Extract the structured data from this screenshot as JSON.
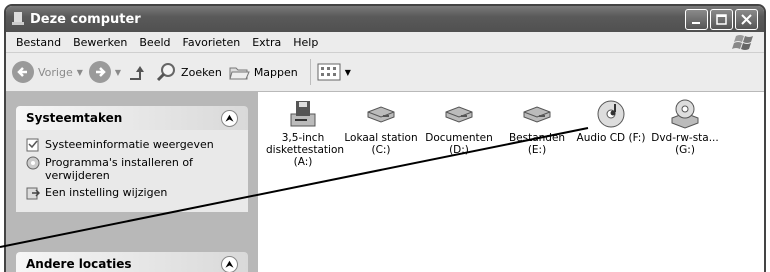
{
  "window": {
    "title": "Deze computer",
    "app_icon": "computer-icon"
  },
  "menubar": {
    "items": [
      "Bestand",
      "Bewerken",
      "Beeld",
      "Favorieten",
      "Extra",
      "Help"
    ]
  },
  "toolbar": {
    "back_label": "Vorige",
    "search_label": "Zoeken",
    "folders_label": "Mappen"
  },
  "sidebar": {
    "system_tasks": {
      "title": "Systeemtaken",
      "items": [
        {
          "label": "Systeeminformatie weergeven",
          "icon": "info-icon"
        },
        {
          "label": "Programma's installeren of verwijderen",
          "icon": "install-icon"
        },
        {
          "label": "Een instelling wijzigen",
          "icon": "settings-icon"
        }
      ]
    },
    "other_places": {
      "title": "Andere locaties"
    }
  },
  "drives": [
    {
      "label": "3,5-inch diskettestation (A:)",
      "icon": "floppy-drive-icon"
    },
    {
      "label": "Lokaal station (C:)",
      "icon": "hard-drive-icon"
    },
    {
      "label": "Documenten (D:)",
      "icon": "hard-drive-icon"
    },
    {
      "label": "Bestanden (E:)",
      "icon": "hard-drive-icon"
    },
    {
      "label": "Audio CD (F:)",
      "icon": "audio-cd-icon"
    },
    {
      "label": "Dvd-rw-sta... (G:)",
      "icon": "dvd-drive-icon"
    }
  ]
}
